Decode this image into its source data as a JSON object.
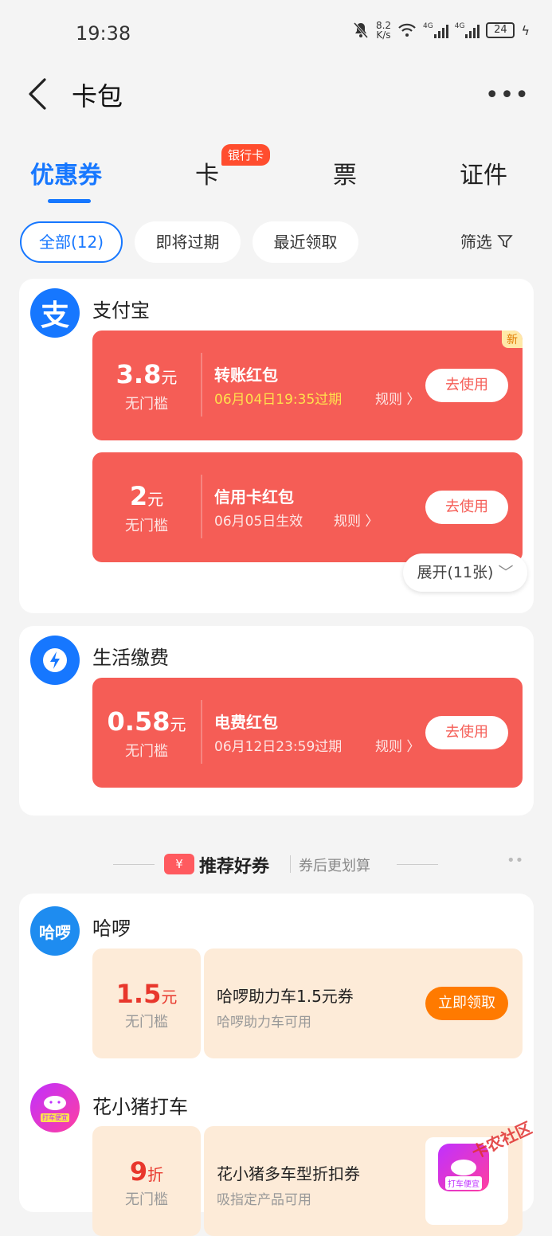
{
  "status": {
    "time": "19:38",
    "net_speed_top": "8.2",
    "net_speed_unit": "K/s",
    "sig1": "4G",
    "sig2": "4G",
    "battery": "24"
  },
  "nav": {
    "title": "卡包",
    "more": "•••"
  },
  "tabs": [
    {
      "label": "优惠券",
      "active": true
    },
    {
      "label": "卡"
    },
    {
      "label": "票"
    },
    {
      "label": "证件"
    }
  ],
  "tab_badge": "银行卡",
  "filters": {
    "all": "全部(12)",
    "expiring": "即将过期",
    "recent": "最近领取",
    "filter": "筛选"
  },
  "alipay": {
    "brand": "支付宝",
    "logo_char": "支",
    "coupons": [
      {
        "amount": "3.8",
        "unit": "元",
        "threshold": "无门槛",
        "name": "转账红包",
        "expiry": "06月04日19:35过期",
        "rule": "规则 〉",
        "action": "去使用",
        "new": "新"
      },
      {
        "amount": "2",
        "unit": "元",
        "threshold": "无门槛",
        "name": "信用卡红包",
        "expiry": "06月05日生效",
        "rule": "规则 〉",
        "action": "去使用"
      }
    ],
    "expand": "展开(11张)"
  },
  "utility": {
    "brand": "生活缴费",
    "coupon": {
      "amount": "0.58",
      "unit": "元",
      "threshold": "无门槛",
      "name": "电费红包",
      "expiry": "06月12日23:59过期",
      "rule": "规则 〉",
      "action": "去使用"
    }
  },
  "recommend": {
    "icon": "¥",
    "title": "推荐好券",
    "subtitle": "券后更划算",
    "dots": "••"
  },
  "hello": {
    "brand": "哈啰",
    "logo_text": "哈啰",
    "coupon": {
      "amount": "1.5",
      "unit": "元",
      "threshold": "无门槛",
      "name": "哈啰助力车1.5元券",
      "desc": "哈啰助力车可用",
      "action": "立即领取"
    }
  },
  "pig": {
    "brand": "花小猪打车",
    "logo_text": "打车便宜",
    "coupon": {
      "amount": "9",
      "unit": "折",
      "threshold": "无门槛",
      "name": "花小猪多车型折扣券",
      "desc": "吸指定产品可用",
      "thumb_text": "打车便宜"
    }
  },
  "watermark": "卡农社区",
  "colors": {
    "accent": "#1677ff",
    "coupon_red": "#f55d56",
    "claim_orange": "#ff7a00"
  }
}
